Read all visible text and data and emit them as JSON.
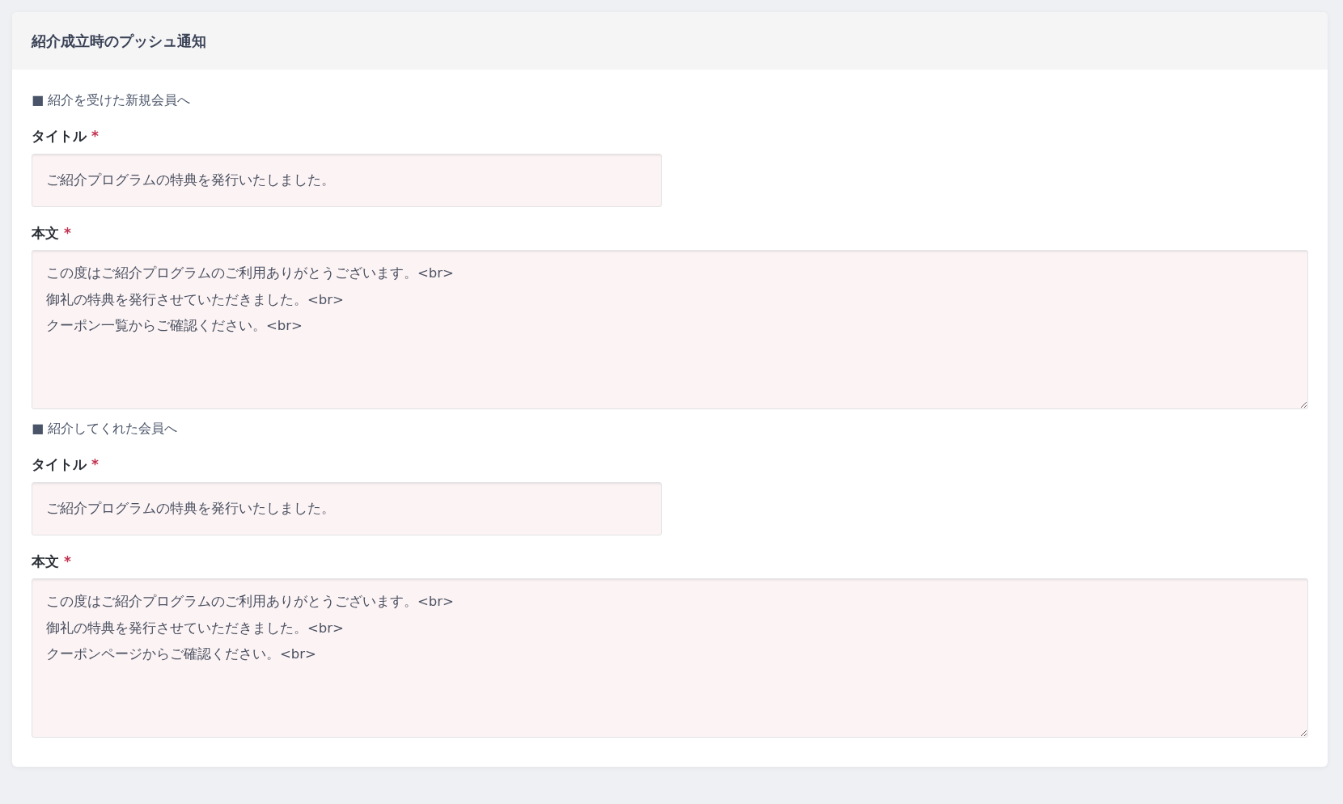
{
  "card": {
    "title": "紹介成立時のプッシュ通知"
  },
  "sections": [
    {
      "heading": "■ 紹介を受けた新規会員へ",
      "fields": [
        {
          "kind": "input",
          "label": "タイトル",
          "required_mark": "*",
          "value": "ご紹介プログラムの特典を発行いたしました。"
        },
        {
          "kind": "textarea",
          "label": "本文",
          "required_mark": "*",
          "value": "この度はご紹介プログラムのご利用ありがとうございます。<br>\n御礼の特典を発行させていただきました。<br>\nクーポン一覧からご確認ください。<br>"
        }
      ]
    },
    {
      "heading": "■ 紹介してくれた会員へ",
      "fields": [
        {
          "kind": "input",
          "label": "タイトル",
          "required_mark": "*",
          "value": "ご紹介プログラムの特典を発行いたしました。"
        },
        {
          "kind": "textarea",
          "label": "本文",
          "required_mark": "*",
          "value": "この度はご紹介プログラムのご利用ありがとうございます。<br>\n御礼の特典を発行させていただきました。<br>\nクーポンページからご確認ください。<br>"
        }
      ]
    }
  ]
}
